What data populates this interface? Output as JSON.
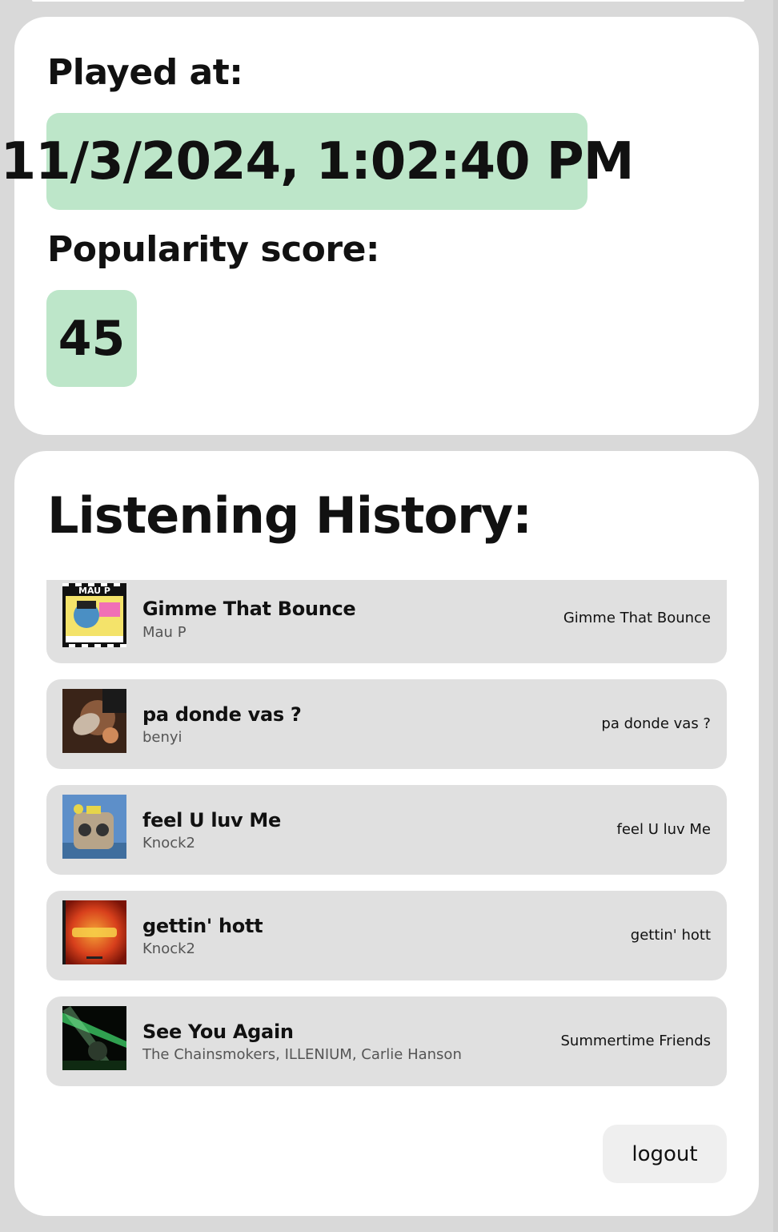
{
  "played_at": {
    "label": "Played at:",
    "value": "11/3/2024, 1:02:40 PM"
  },
  "popularity": {
    "label": "Popularity score:",
    "value": "45"
  },
  "history": {
    "title": "Listening History:",
    "tracks": [
      {
        "title": "Gimme That Bounce",
        "artist": "Mau P",
        "album": "Gimme That Bounce",
        "art": "gimme-that-bounce-cover"
      },
      {
        "title": "pa donde vas ?",
        "artist": "benyi",
        "album": "pa donde vas ?",
        "art": "pa-donde-vas-cover"
      },
      {
        "title": "feel U luv Me",
        "artist": "Knock2",
        "album": "feel U luv Me",
        "art": "feel-u-luv-me-cover"
      },
      {
        "title": "gettin' hott",
        "artist": "Knock2",
        "album": "gettin' hott",
        "art": "gettin-hott-cover"
      },
      {
        "title": "See You Again",
        "artist": "The Chainsmokers, ILLENIUM, Carlie Hanson",
        "album": "Summertime Friends",
        "art": "summertime-friends-cover"
      }
    ]
  },
  "logout": {
    "label": "logout"
  },
  "colors": {
    "background": "#d9d9d9",
    "card": "#ffffff",
    "pill_green": "#bde6c9",
    "track_row": "#e0e0e0",
    "button": "#efefef"
  }
}
